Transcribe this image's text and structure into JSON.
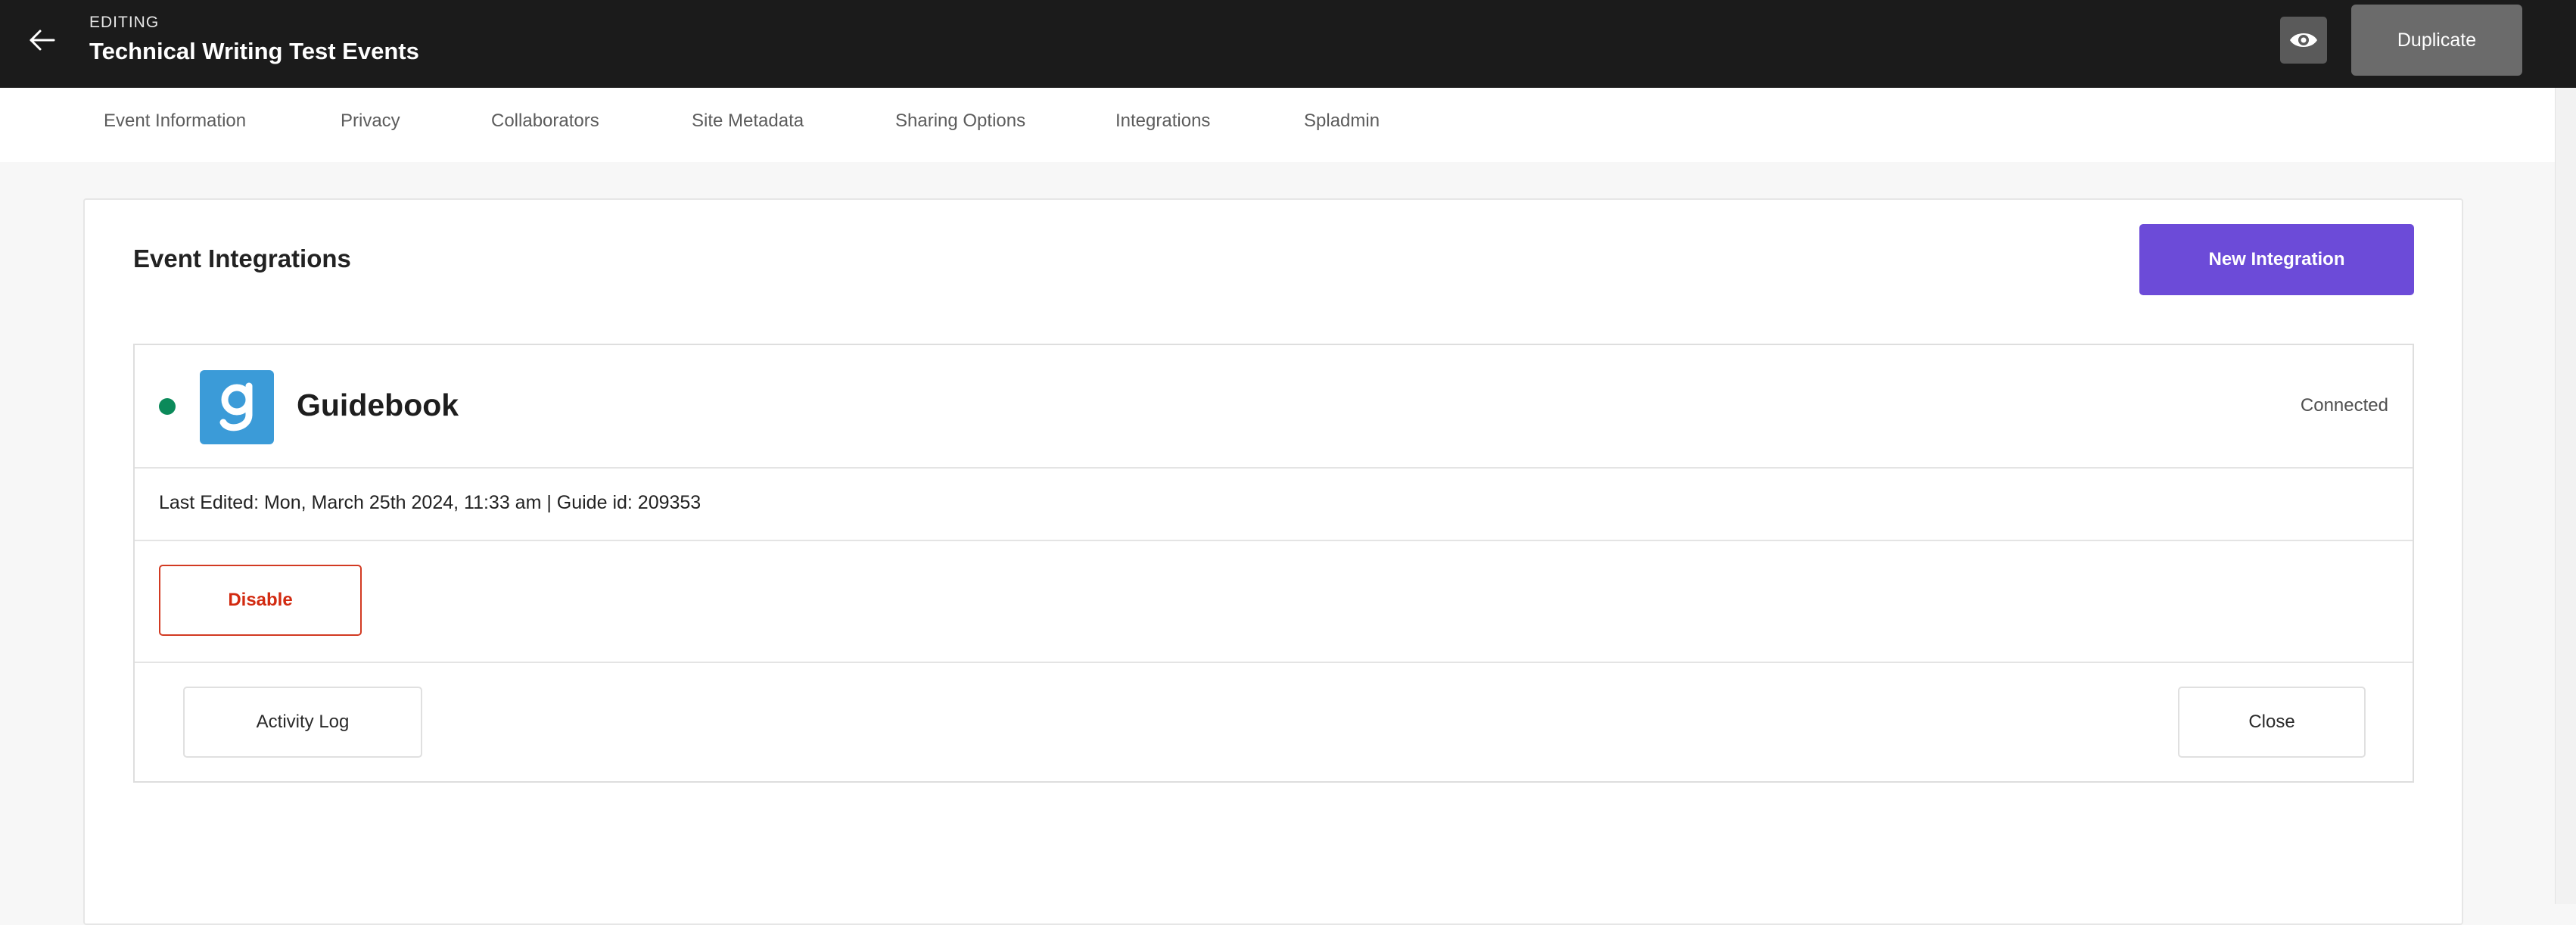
{
  "header": {
    "editing_label": "EDITING",
    "event_title": "Technical Writing Test Events",
    "back_icon": "arrow-left-icon",
    "preview_icon": "eye-icon",
    "duplicate_label": "Duplicate"
  },
  "tabs": [
    {
      "label": "Event Information"
    },
    {
      "label": "Privacy"
    },
    {
      "label": "Collaborators"
    },
    {
      "label": "Site Metadata"
    },
    {
      "label": "Sharing Options"
    },
    {
      "label": "Integrations"
    },
    {
      "label": "Spladmin"
    }
  ],
  "main": {
    "section_title": "Event Integrations",
    "new_integration_label": "New Integration",
    "integration": {
      "name": "Guidebook",
      "logo_icon": "guidebook-logo-icon",
      "logo_letter": "g",
      "status": "Connected",
      "status_color": "#0b8a5a",
      "meta": "Last Edited: Mon, March 25th 2024, 11:33 am | Guide id: 209353",
      "disable_label": "Disable",
      "activity_log_label": "Activity Log",
      "close_label": "Close"
    }
  },
  "colors": {
    "header_bg": "#1b1b1b",
    "accent": "#6c4bd8",
    "danger": "#d22a10",
    "guidebook_blue": "#3b9bd8"
  }
}
